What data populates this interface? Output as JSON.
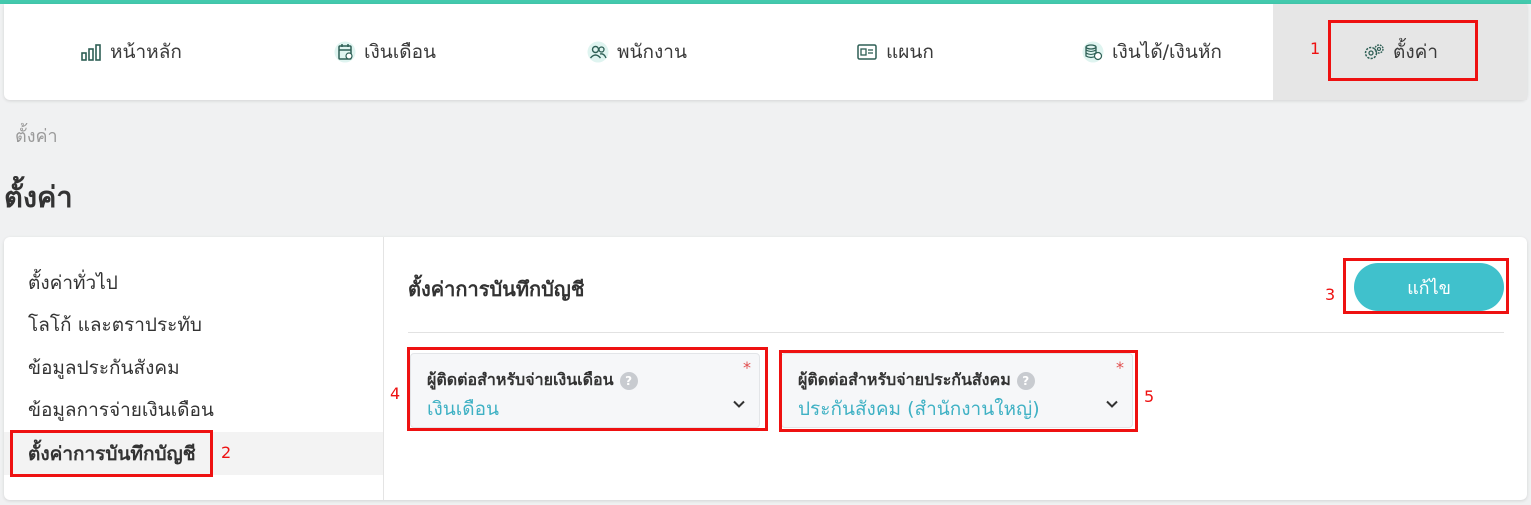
{
  "nav": {
    "items": [
      {
        "label": "หน้าหลัก",
        "icon": "bar-chart-icon"
      },
      {
        "label": "เงินเดือน",
        "icon": "payroll-calendar-icon"
      },
      {
        "label": "พนักงาน",
        "icon": "users-icon"
      },
      {
        "label": "แผนก",
        "icon": "id-card-icon"
      },
      {
        "label": "เงินได้/เงินหัก",
        "icon": "coins-icon"
      },
      {
        "label": "ตั้งค่า",
        "icon": "gears-icon"
      }
    ]
  },
  "breadcrumb": "ตั้งค่า",
  "page_title": "ตั้งค่า",
  "sidebar": {
    "items": [
      {
        "label": "ตั้งค่าทั่วไป"
      },
      {
        "label": "โลโก้ และตราประทับ"
      },
      {
        "label": "ข้อมูลประกันสังคม"
      },
      {
        "label": "ข้อมูลการจ่ายเงินเดือน"
      },
      {
        "label": "ตั้งค่าการบันทึกบัญชี"
      }
    ]
  },
  "section": {
    "title": "ตั้งค่าการบันทึกบัญชี",
    "edit_label": "แก้ไข",
    "fields": [
      {
        "label": "ผู้ติดต่อสำหรับจ่ายเงินเดือน",
        "value": "เงินเดือน",
        "required_mark": "*",
        "help": "?"
      },
      {
        "label": "ผู้ติดต่อสำหรับจ่ายประกันสังคม",
        "value": "ประกันสังคม (สำนักงานใหญ่)",
        "required_mark": "*",
        "help": "?"
      }
    ]
  },
  "annotations": [
    "1",
    "2",
    "3",
    "4",
    "5"
  ],
  "colors": {
    "accent": "#40c1cc",
    "value_text": "#3fb1c4",
    "top_strip": "#43c9ad",
    "annotation": "#ee1111"
  }
}
